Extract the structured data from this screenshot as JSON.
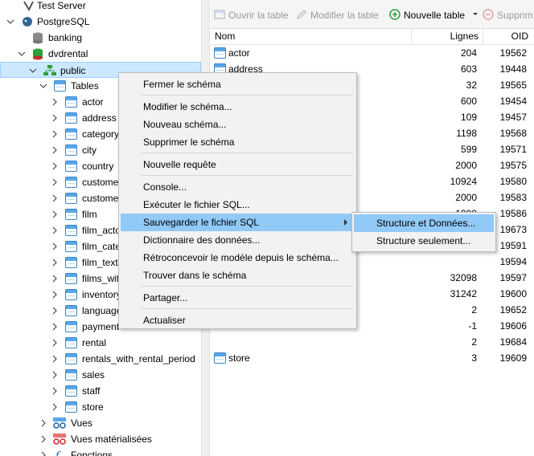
{
  "tree": {
    "nodes": [
      {
        "label": "Test Server",
        "icon": "server-icon",
        "chevron": ""
      },
      {
        "label": "PostgreSQL",
        "icon": "postgresql-icon",
        "chevron": "v"
      },
      {
        "label": "banking",
        "icon": "database-icon",
        "chevron": ""
      },
      {
        "label": "dvdrental",
        "icon": "database-icon",
        "chevron": "v"
      },
      {
        "label": "public",
        "icon": "schema-icon",
        "chevron": "v"
      },
      {
        "label": "Tables",
        "icon": "tables-folder-icon",
        "chevron": "v"
      },
      {
        "label": "actor",
        "icon": "table-icon",
        "chevron": ">"
      },
      {
        "label": "address",
        "icon": "table-icon",
        "chevron": ">"
      },
      {
        "label": "category",
        "icon": "table-icon",
        "chevron": ">"
      },
      {
        "label": "city",
        "icon": "table-icon",
        "chevron": ">"
      },
      {
        "label": "country",
        "icon": "table-icon",
        "chevron": ">"
      },
      {
        "label": "customer",
        "icon": "table-icon",
        "chevron": ">"
      },
      {
        "label": "customer_list",
        "icon": "table-icon",
        "chevron": ">"
      },
      {
        "label": "film",
        "icon": "table-icon",
        "chevron": ">"
      },
      {
        "label": "film_actor",
        "icon": "table-icon",
        "chevron": ">"
      },
      {
        "label": "film_category",
        "icon": "table-icon",
        "chevron": ">"
      },
      {
        "label": "film_text",
        "icon": "table-icon",
        "chevron": ">"
      },
      {
        "label": "films_with_rental",
        "icon": "table-icon",
        "chevron": ">"
      },
      {
        "label": "inventory",
        "icon": "table-icon",
        "chevron": ">"
      },
      {
        "label": "language",
        "icon": "table-icon",
        "chevron": ">"
      },
      {
        "label": "payment",
        "icon": "table-icon",
        "chevron": ">"
      },
      {
        "label": "rental",
        "icon": "table-icon",
        "chevron": ">"
      },
      {
        "label": "rentals_with_rental_period",
        "icon": "table-icon",
        "chevron": ">"
      },
      {
        "label": "sales",
        "icon": "table-icon",
        "chevron": ">"
      },
      {
        "label": "staff",
        "icon": "table-icon",
        "chevron": ">"
      },
      {
        "label": "store",
        "icon": "table-icon",
        "chevron": ">"
      },
      {
        "label": "Vues",
        "icon": "views-icon",
        "chevron": ">"
      },
      {
        "label": "Vues matérialisées",
        "icon": "materialized-views-icon",
        "chevron": ">"
      },
      {
        "label": "Fonctions",
        "icon": "functions-icon",
        "chevron": ">"
      }
    ]
  },
  "toolbar": {
    "open_table": "Ouvrir la table",
    "edit_table": "Modifier la table",
    "new_table": "Nouvelle table",
    "delete": "Supprim"
  },
  "table": {
    "headers": {
      "name": "Nom",
      "rows": "Lignes",
      "oid": "OID"
    },
    "rows": [
      {
        "name": "actor",
        "rows": "204",
        "oid": "19562"
      },
      {
        "name": "address",
        "rows": "603",
        "oid": "19448"
      },
      {
        "name": "",
        "rows": "32",
        "oid": "19565"
      },
      {
        "name": "",
        "rows": "600",
        "oid": "19454"
      },
      {
        "name": "",
        "rows": "109",
        "oid": "19457"
      },
      {
        "name": "",
        "rows": "1198",
        "oid": "19568"
      },
      {
        "name": "",
        "rows": "599",
        "oid": "19571"
      },
      {
        "name": "",
        "rows": "2000",
        "oid": "19575"
      },
      {
        "name": "",
        "rows": "10924",
        "oid": "19580"
      },
      {
        "name": "",
        "rows": "2000",
        "oid": "19583"
      },
      {
        "name": "",
        "rows": "1998",
        "oid": "19586"
      },
      {
        "name": "",
        "rows": "",
        "oid": "19673"
      },
      {
        "name": "",
        "rows": "",
        "oid": "19591"
      },
      {
        "name": "",
        "rows": "",
        "oid": "19594"
      },
      {
        "name": "",
        "rows": "32098",
        "oid": "19597"
      },
      {
        "name": "",
        "rows": "31242",
        "oid": "19600"
      },
      {
        "name": "",
        "rows": "2",
        "oid": "19652"
      },
      {
        "name": "",
        "rows": "-1",
        "oid": "19606"
      },
      {
        "name": "",
        "rows": "2",
        "oid": "19684"
      },
      {
        "name": "store",
        "rows": "3",
        "oid": "19609"
      }
    ]
  },
  "context_menu": {
    "items": [
      "Fermer le schéma",
      "Modifier le schéma...",
      "Nouveau schéma...",
      "Supprimer le schéma",
      "Nouvelle requête",
      "Console...",
      "Exécuter le fichier SQL...",
      "Sauvegarder le fichier SQL",
      "Dictionnaire des données...",
      "Rétroconcevoir le modèle depuis le schéma...",
      "Trouver dans le schéma",
      "Partager...",
      "Actualiser"
    ],
    "submenu": [
      "Structure et Données...",
      "Structure seulement..."
    ]
  },
  "colors": {
    "selection": "#cce8ff",
    "menu_highlight": "#91c9f7",
    "new_table_icon": "#2e9e3a"
  }
}
